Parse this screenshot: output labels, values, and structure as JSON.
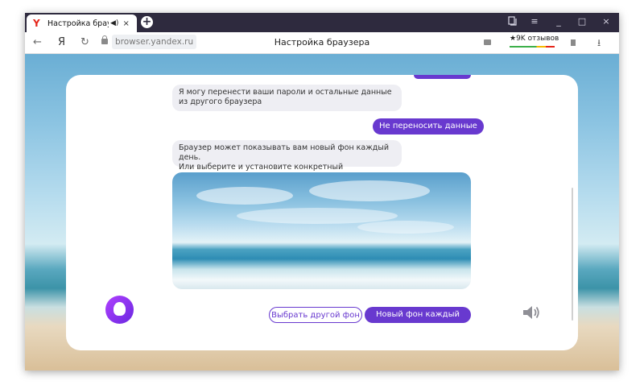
{
  "browser": {
    "tab": {
      "title": "Настройка браузера",
      "favicon": "Y",
      "audio_icon": "speaker-icon",
      "close": "×"
    },
    "new_tab": "+",
    "window_controls": {
      "collections": "collections-icon",
      "menu": "≡",
      "minimize": "_",
      "maximize": "□",
      "close": "×"
    },
    "nav": {
      "back": "←",
      "home": "Я",
      "reload": "↻"
    },
    "url": "browser.yandex.ru",
    "page_title": "Настройка браузера",
    "reviews": {
      "star": "★",
      "label": "9K отзывов"
    },
    "download": "⭳"
  },
  "chat": {
    "msg1": "Я могу перенести ваши пароли и остальные данные\nиз другого браузера",
    "reply1": "Не переносить данные",
    "msg2": "Браузер может показывать вам новый фон каждый день.\nИли выберите и установите конкретный"
  },
  "buttons": {
    "choose_other": "Выбрать другой фон",
    "new_each_day": "Новый фон каждый день"
  },
  "colors": {
    "accent": "#6839cf",
    "titlebar": "#2e2a3e",
    "bubble_in": "#eeeef3"
  }
}
